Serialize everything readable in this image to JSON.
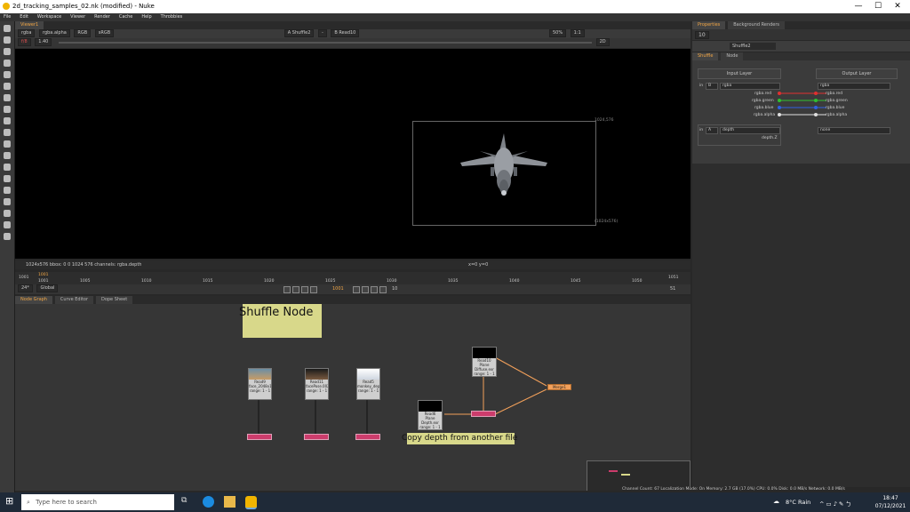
{
  "window": {
    "title": "2d_tracking_samples_02.nk (modified) - Nuke",
    "min": "—",
    "max": "☐",
    "close": "✕"
  },
  "menu": [
    "File",
    "Edit",
    "Workspace",
    "Viewer",
    "Render",
    "Cache",
    "Help",
    "Throbbies"
  ],
  "viewer": {
    "tab": "Viewer1",
    "channels": "rgba",
    "alpha": "rgba.alpha",
    "colorspace": "RGB",
    "lut": "sRGB",
    "input_a": "A  Shuffle2",
    "input_dash": "-",
    "input_b": "B  Read10",
    "zoom": "50%",
    "ratio": "1:1",
    "gain_label": "f/8",
    "gain_value": "1.40",
    "mode": "2D",
    "format_top": "1024,576",
    "format_bottom": "(1024x576)",
    "status_left": "1024x576  bbox: 0 0 1024 576  channels: rgba.depth",
    "status_coords": "x=0 y=0"
  },
  "timeline": {
    "start": "1001",
    "ticks": [
      "1001",
      "1005",
      "1010",
      "1015",
      "1020",
      "1025",
      "1030",
      "1035",
      "1040",
      "1045",
      "1050"
    ],
    "end": "1051",
    "current": "1001",
    "fps": "24*",
    "range_mode": "Global",
    "step": "10",
    "end_label": "51"
  },
  "nodegraph": {
    "tabs": [
      "Node Graph",
      "Curve Editor",
      "Dope Sheet"
    ],
    "sticky_title": "Shuffle Node",
    "sticky_caption": "Copy depth from another file",
    "nodes": [
      {
        "name": "Read9",
        "file": "face_2048x1556.exr",
        "info": "range: 1 - 1"
      },
      {
        "name": "Read11",
        "file": "facePose.0028.exr",
        "info": "range: 1 - 1"
      },
      {
        "name": "Read5",
        "file": "monkey_depth0003.exr",
        "info": "range: 1 - 1"
      },
      {
        "name": "Read6",
        "file": "Plane Depth.exr",
        "info": "range: 1 - 1"
      },
      {
        "name": "Read10",
        "file": "Plane Diffuse.exr",
        "info": "range: 1 - 1"
      }
    ],
    "merge_label": "Merge1"
  },
  "properties": {
    "tabs": [
      "Properties",
      "Background Renders"
    ],
    "count": "10",
    "node_name": "Shuffle2",
    "subtabs": [
      "Shuffle",
      "Node"
    ],
    "input_layer_title": "Input Layer",
    "output_layer_title": "Output Layer",
    "in1": "in",
    "in1_source": "B",
    "in1_layer": "rgba",
    "out_layer": "rgba",
    "in_channels": [
      "rgba.red",
      "rgba.green",
      "rgba.blue",
      "rgba.alpha"
    ],
    "out_channels": [
      "rgba.red",
      "rgba.green",
      "rgba.blue",
      "rgba.alpha"
    ],
    "in2": "in",
    "in2_source": "A",
    "in2_layer": "depth",
    "in2_channel": "depth.Z",
    "out2_layer": "none",
    "channel_colors": [
      "#e03030",
      "#30c030",
      "#3060e0",
      "#e0e0e0"
    ]
  },
  "status_line": "Channel Count: 67  Localization Mode: On  Memory: 2.7 GB (17.0%)  CPU: 0.0%  Disk: 0.0 MB/s  Network: 0.0 MB/s",
  "taskbar": {
    "search_placeholder": "Type here to search",
    "weather": "8°C  Rain",
    "time": "18:47",
    "date": "07/12/2021"
  }
}
